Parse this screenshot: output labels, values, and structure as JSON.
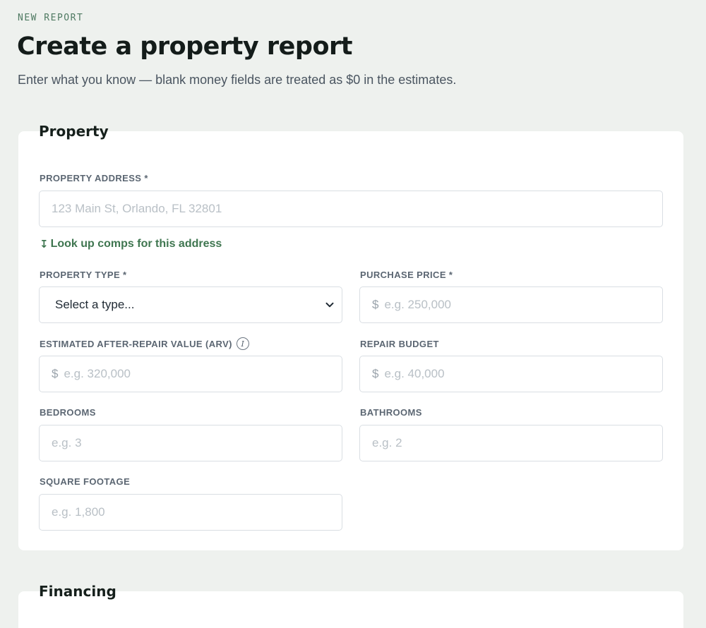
{
  "header": {
    "eyebrow": "NEW REPORT",
    "title": "Create a property report",
    "subtitle": "Enter what you know — blank money fields are treated as $0 in the estimates."
  },
  "property_section": {
    "legend": "Property",
    "address": {
      "label": "PROPERTY ADDRESS *",
      "placeholder": "123 Main St, Orlando, FL 32801",
      "value": ""
    },
    "lookup_link": {
      "icon": "arrow-down-icon",
      "glyph": "↧",
      "label": "Look up comps for this address"
    },
    "property_type": {
      "label": "PROPERTY TYPE *",
      "selected": "Select a type..."
    },
    "purchase_price": {
      "label": "PURCHASE PRICE *",
      "currency": "$",
      "placeholder": "e.g. 250,000"
    },
    "arv": {
      "label": "ESTIMATED AFTER-REPAIR VALUE (ARV)",
      "info_glyph": "i",
      "currency": "$",
      "placeholder": "e.g. 320,000"
    },
    "repair_budget": {
      "label": "REPAIR BUDGET",
      "currency": "$",
      "placeholder": "e.g. 40,000"
    },
    "bedrooms": {
      "label": "BEDROOMS",
      "placeholder": "e.g. 3"
    },
    "bathrooms": {
      "label": "BATHROOMS",
      "placeholder": "e.g. 2"
    },
    "square_footage": {
      "label": "SQUARE FOOTAGE",
      "placeholder": "e.g. 1,800"
    }
  },
  "financing_section": {
    "legend": "Financing"
  },
  "colors": {
    "page_background": "#eef1ee",
    "card_background": "#ffffff",
    "accent_green": "#3f7650",
    "eyebrow_green": "#4f7a62",
    "label_gray": "#5b6672",
    "border": "#d9dee3"
  }
}
